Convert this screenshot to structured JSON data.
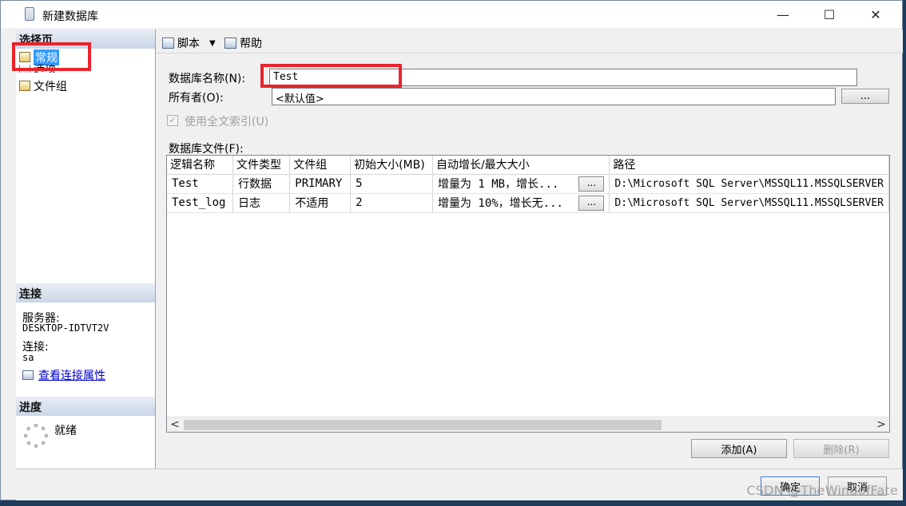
{
  "window": {
    "title": "新建数据库",
    "controls": {
      "minimize": "—",
      "maximize": "☐",
      "close": "✕"
    }
  },
  "sidebar": {
    "select_page_header": "选择页",
    "items": [
      {
        "label": "常规",
        "selected": true,
        "icon": "wrench-page-icon"
      },
      {
        "label": "选项",
        "selected": false,
        "icon": "page-icon"
      },
      {
        "label": "文件组",
        "selected": false,
        "icon": "wrench-page-icon"
      }
    ],
    "connection_header": "连接",
    "server_label": "服务器:",
    "server_value": "DESKTOP-IDTVT2V",
    "connection_label": "连接:",
    "connection_value": "sa",
    "view_connection_properties": "查看连接属性",
    "progress_header": "进度",
    "progress_status": "就绪"
  },
  "toolbar": {
    "script_label": "脚本",
    "help_label": "帮助"
  },
  "form": {
    "db_name_label": "数据库名称(N):",
    "db_name_value": "Test",
    "owner_label": "所有者(O):",
    "owner_value": "<默认值>",
    "owner_browse": "...",
    "fulltext_label": "使用全文索引(U)",
    "fulltext_checked": true,
    "db_files_label": "数据库文件(F):"
  },
  "grid": {
    "columns": [
      "逻辑名称",
      "文件类型",
      "文件组",
      "初始大小(MB)",
      "自动增长/最大大小",
      "路径"
    ],
    "rows": [
      {
        "logical_name": "Test",
        "file_type": "行数据",
        "filegroup": "PRIMARY",
        "initial_size": "5",
        "autogrowth": "增量为 1 MB，增长...",
        "browse": "...",
        "path": "D:\\Microsoft SQL Server\\MSSQL11.MSSQLSERVER"
      },
      {
        "logical_name": "Test_log",
        "file_type": "日志",
        "filegroup": "不适用",
        "initial_size": "2",
        "autogrowth": "增量为 10%，增长无...",
        "browse": "...",
        "path": "D:\\Microsoft SQL Server\\MSSQL11.MSSQLSERVER"
      }
    ],
    "scroll_left": "<",
    "scroll_right": ">"
  },
  "buttons": {
    "add": "添加(A)",
    "remove": "删除(R)",
    "ok": "确定",
    "cancel": "取消"
  },
  "watermark": "CSDN @TheWindofFate",
  "accent_colors": {
    "selection": "#3399ff",
    "highlight_box": "#e8242c",
    "link": "#0000cc"
  }
}
